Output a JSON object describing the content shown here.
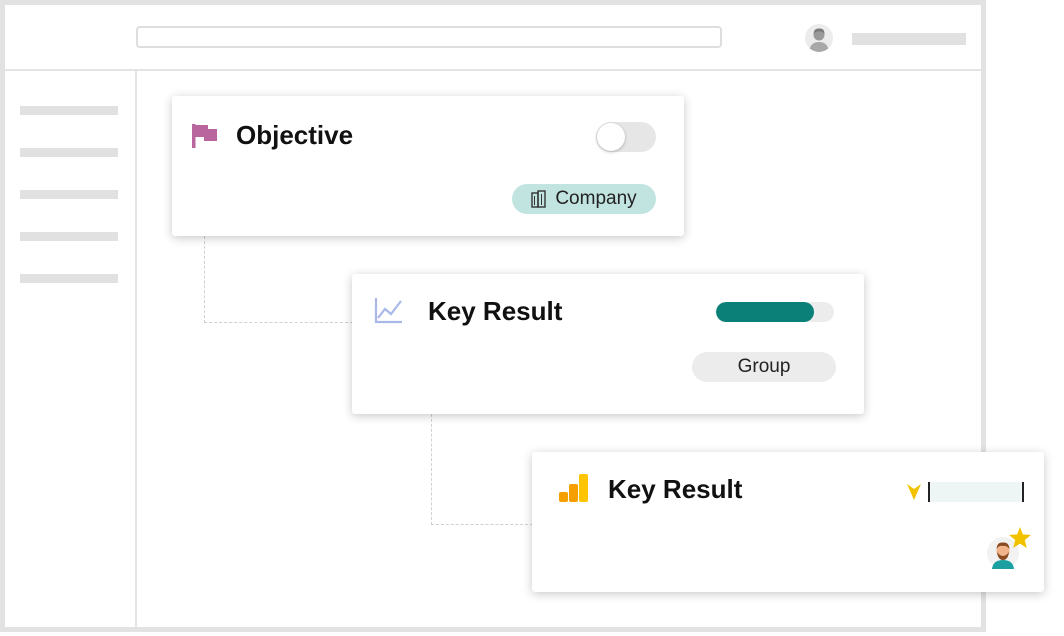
{
  "colors": {
    "objective_flag": "#b9659e",
    "company_chip_bg": "#c2e4e0",
    "group_chip_bg": "#ececec",
    "progress_fill": "#0b8079",
    "line_chart_icon": "#a9b8e8",
    "bar_icon_orange": "#f5a000",
    "bar_icon_yellow": "#ffc400",
    "arrow_down": "#f2c200",
    "star": "#f2c200"
  },
  "header": {
    "search_placeholder": "",
    "user_avatar_icon": "user-avatar-icon"
  },
  "objective_card": {
    "icon": "flag-icon",
    "title": "Objective",
    "toggle_on": false,
    "chip_icon": "building-icon",
    "chip_label": "Company"
  },
  "key_result_card_1": {
    "icon": "line-chart-icon",
    "title": "Key Result",
    "progress": 0.83,
    "chip_label": "Group"
  },
  "key_result_card_2": {
    "icon": "bar-chart-icon",
    "title": "Key Result",
    "trend_icon": "arrow-down-icon",
    "owner_icon": "owner-avatar-icon",
    "badge_icon": "star-icon"
  }
}
